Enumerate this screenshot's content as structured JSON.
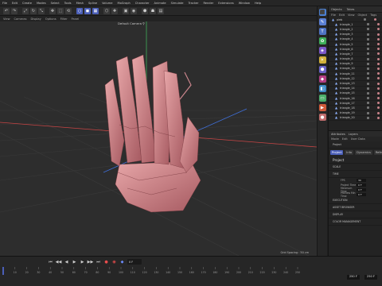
{
  "menubar": {
    "items": [
      "File",
      "Edit",
      "Create",
      "Modes",
      "Select",
      "Tools",
      "Mesh",
      "Spline",
      "Volume",
      "MoGraph",
      "Character",
      "Animate",
      "Simulate",
      "Tracker",
      "Render",
      "Extensions",
      "Window",
      "Help"
    ]
  },
  "toolbar": {
    "groups": [
      [
        "↶",
        "↷"
      ],
      [
        "⤢",
        "↻",
        "⤡"
      ],
      [
        "✥",
        "⬚",
        "⟲"
      ],
      [
        "○",
        "◼",
        "▦"
      ],
      [
        "⬡",
        "✚"
      ],
      [
        "▣",
        "◉"
      ],
      [
        "⬢",
        "☗",
        "▤"
      ]
    ]
  },
  "viewport": {
    "menu": [
      "View",
      "Cameras",
      "Display",
      "Options",
      "Filter",
      "Panel"
    ],
    "camera_label": "Default Camera ⚲",
    "grid_spacing": "Grid Spacing : 50 cm"
  },
  "right_icons": [
    {
      "name": "cube-icon",
      "glyph": "⬛",
      "color": "#4a7fd3"
    },
    {
      "name": "pen-icon",
      "glyph": "✎",
      "color": "#5b80d4"
    },
    {
      "name": "text-icon",
      "glyph": "T",
      "color": "#4f73c4"
    },
    {
      "name": "cloner-icon",
      "glyph": "✿",
      "color": "#3fae5a"
    },
    {
      "name": "deformer-icon",
      "glyph": "◈",
      "color": "#7b57c9"
    },
    {
      "name": "light-icon",
      "glyph": "☀",
      "color": "#d2b13a"
    },
    {
      "name": "scene-icon",
      "glyph": "⬢",
      "color": "#6a64c9"
    },
    {
      "name": "effector-icon",
      "glyph": "◆",
      "color": "#b43d84"
    },
    {
      "name": "camera-icon",
      "glyph": "◧",
      "color": "#3e8bc7"
    },
    {
      "name": "floor-icon",
      "glyph": "▭",
      "color": "#4cae6a"
    },
    {
      "name": "render-icon",
      "glyph": "▶",
      "color": "#d05a3a"
    },
    {
      "name": "material-icon",
      "glyph": "●",
      "color": "#c06d6d"
    }
  ],
  "objects": {
    "tabs": [
      "Objects",
      "Takes"
    ],
    "menu": [
      "File",
      "Edit",
      "View",
      "Object",
      "Tags"
    ],
    "rows": [
      "pieb",
      "triangle_1",
      "triangle_2",
      "triangle_3",
      "triangle_4",
      "triangle_5",
      "triangle_6",
      "triangle_7",
      "triangle_8",
      "triangle_9",
      "triangle_10",
      "triangle_11",
      "triangle_12",
      "triangle_13",
      "triangle_14",
      "triangle_15",
      "triangle_16",
      "triangle_17",
      "triangle_18",
      "triangle_19",
      "triangle_20"
    ]
  },
  "attributes": {
    "tabs": [
      "Attributes",
      "Layers"
    ],
    "menu": [
      "Mode",
      "Edit",
      "User Data"
    ],
    "object_label": "Project",
    "subtabs": [
      "Project",
      "Info",
      "Dynamics",
      "Referencing"
    ],
    "title": "Project",
    "sections": [
      "SCALE",
      "TIME"
    ],
    "fields": [
      {
        "label": "FPS",
        "value": "30"
      },
      {
        "label": "Project Time",
        "value": "0 F"
      },
      {
        "label": "Minimum Time",
        "value": "0 F"
      },
      {
        "label": "Preview Min Time",
        "value": "0 F"
      }
    ],
    "more_sections": [
      "EXECUTION",
      "ASSET BROWSER",
      "DISPLAY",
      "COLOR MANAGEMENT"
    ]
  },
  "timeline": {
    "frame_box": "250 F",
    "current_frame": "0 F",
    "ticks": [
      "0",
      "10",
      "20",
      "30",
      "40",
      "50",
      "60",
      "70",
      "80",
      "90",
      "100",
      "110",
      "120",
      "130",
      "140",
      "150",
      "160",
      "170",
      "180",
      "190",
      "200",
      "210",
      "220",
      "230",
      "240",
      "250"
    ],
    "status_left": "250 F",
    "status_right": "250 F"
  },
  "colors": {
    "accent": "#4b5fb8",
    "hand": "#c9858c",
    "axis_x": "#c84545",
    "axis_z": "#3f6fd8",
    "axis_y": "#3fae5a"
  }
}
